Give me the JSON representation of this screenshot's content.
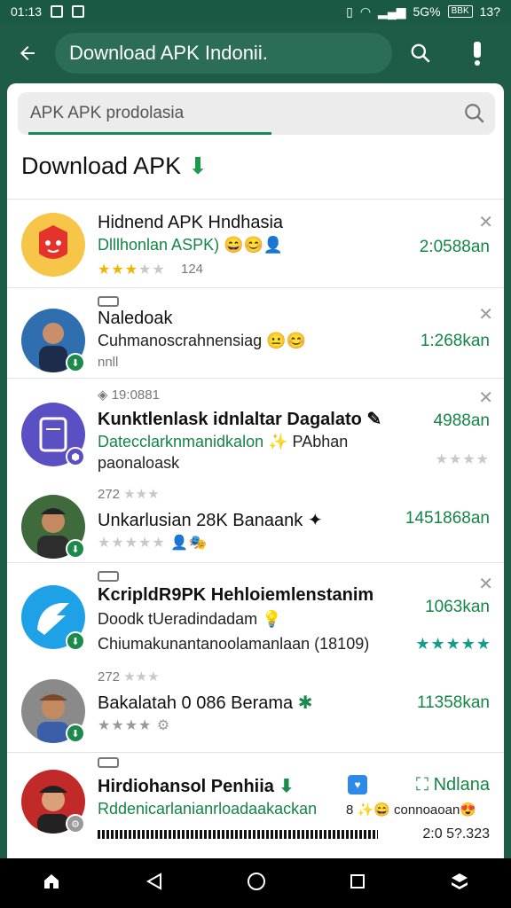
{
  "status_bar": {
    "time": "01:13",
    "battery_text": "BBK",
    "network": "5G%",
    "clock_right": "13?"
  },
  "app_bar": {
    "search_text": "Download APK Indonii."
  },
  "inner_search": {
    "placeholder": "APK APK prodolasia"
  },
  "section": {
    "title": "Download APK"
  },
  "items": [
    {
      "title": "Hidnend APK Hndhasia",
      "subtitle": "Dlllhonlan ASPK)",
      "rating_count": "124",
      "price": "2:0588an"
    },
    {
      "title": "Naledoak",
      "subtitle": "Cuhmanoscrahnensiag",
      "extra": "nnll",
      "price": "1:268kan"
    },
    {
      "meta": "19:0881",
      "title": "Kunktlenlask idnlaltar Dagalato",
      "subtitle": "Datecclarknmanidkalon",
      "subtitle2": "PAbhan",
      "line3": "paonaloask",
      "price": "4988an"
    },
    {
      "meta": "272",
      "title": "Unkarlusian 28K Banaank",
      "price": "1451868an"
    },
    {
      "title": "KcripldR9PK Hehloiemlenstanim",
      "subtitle": "Doodk tUeradindadam",
      "line3": "Chiumakunantanoolamanlaan (18109)",
      "price": "1063kan"
    },
    {
      "meta": "272",
      "title": "Bakalatah 0 086 Berama",
      "price": "11358kan"
    },
    {
      "title": "Hirdiohansol Penhiia",
      "subtitle": "Rddenicarlanianrloadaakackan",
      "meta_right": "Ndlana",
      "emoji_text": "8",
      "sub_right": "connoaoan",
      "bottom_right": "2:0 5?.323"
    }
  ],
  "colors": {
    "primary": "#1e5c48",
    "accent": "#148546",
    "star": "#f2b400"
  },
  "icons": [
    "back-arrow-icon",
    "search-icon",
    "more-icon",
    "close-icon",
    "home-icon",
    "back-icon",
    "circle-home-icon",
    "recents-icon",
    "app-logo-icon"
  ]
}
